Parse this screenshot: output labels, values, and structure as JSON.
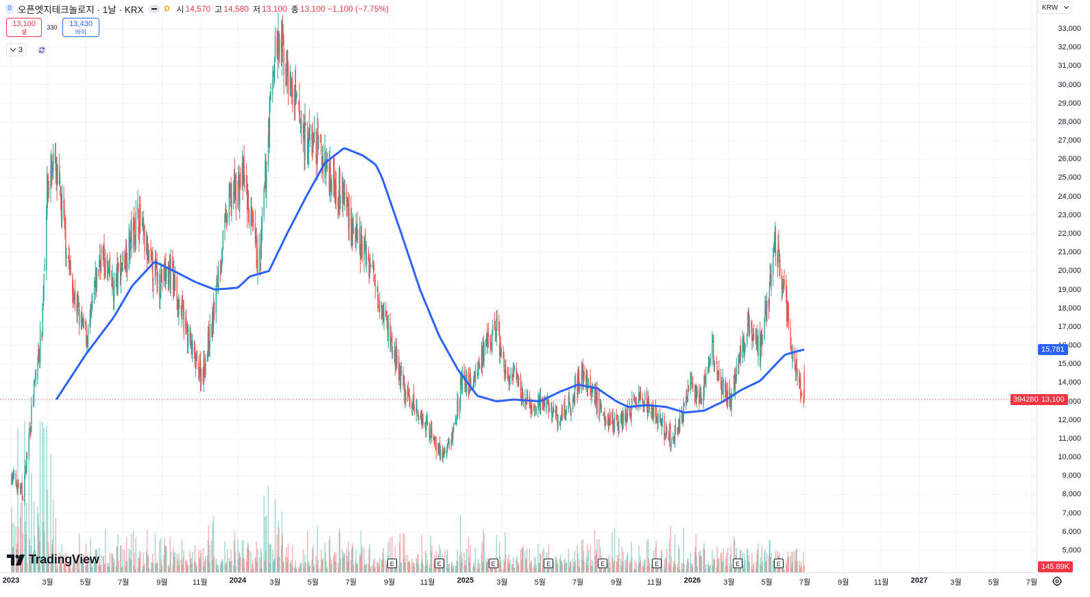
{
  "header": {
    "symbol_icon": "0",
    "title": "오픈엣지테크놀로지 · 1날 · KRX",
    "interval_badge": "D",
    "ohlc": [
      {
        "key": "시",
        "value": "14,570"
      },
      {
        "key": "고",
        "value": "14,580"
      },
      {
        "key": "저",
        "value": "13,100"
      },
      {
        "key": "종",
        "value": "13,100 −1,100 (−7.75%)"
      }
    ]
  },
  "trade": {
    "sell_price": "13,100",
    "sell_label": "셀",
    "spread": "330",
    "buy_price": "13,430",
    "buy_label": "바이"
  },
  "indicators": {
    "count": "3"
  },
  "currency": "KRW",
  "logo_text": "TradingView",
  "price_axis": {
    "ticks": [
      "33,000",
      "32,000",
      "31,000",
      "30,000",
      "29,000",
      "28,000",
      "27,000",
      "26,000",
      "25,000",
      "24,000",
      "23,000",
      "22,000",
      "21,000",
      "20,000",
      "19,000",
      "18,000",
      "17,000",
      "16,000",
      "15,000",
      "14,000",
      "13,000",
      "12,000",
      "11,000",
      "10,000",
      "9,000",
      "8,000",
      "7,000",
      "6,000",
      "5,000"
    ],
    "last_price_label": "13,100",
    "ma_label": "15,781",
    "volume_label": "145.89K",
    "volume_count_label": "394280"
  },
  "time_axis": {
    "labels": [
      {
        "text": "2023",
        "year": true
      },
      {
        "text": "3월"
      },
      {
        "text": "5월"
      },
      {
        "text": "7월"
      },
      {
        "text": "9월"
      },
      {
        "text": "11월"
      },
      {
        "text": "2024",
        "year": true
      },
      {
        "text": "3월"
      },
      {
        "text": "5월"
      },
      {
        "text": "7월"
      },
      {
        "text": "9월"
      },
      {
        "text": "11월"
      },
      {
        "text": "2025",
        "year": true
      },
      {
        "text": "3월"
      },
      {
        "text": "5월"
      },
      {
        "text": "7월"
      },
      {
        "text": "9월"
      },
      {
        "text": "11월"
      },
      {
        "text": "2026",
        "year": true
      },
      {
        "text": "3월"
      },
      {
        "text": "5월"
      },
      {
        "text": "7월"
      },
      {
        "text": "9월"
      },
      {
        "text": "11월"
      },
      {
        "text": "2027",
        "year": true
      },
      {
        "text": "3월"
      },
      {
        "text": "5월"
      },
      {
        "text": "7월"
      }
    ]
  },
  "events": [
    "E",
    "E",
    "E",
    "E",
    "E",
    "E",
    "E",
    "E"
  ],
  "colors": {
    "up": "#26a69a",
    "down": "#ef5350",
    "ma": "#2962ff",
    "last_price": "#f23645"
  },
  "chart_data": {
    "type": "candlestick",
    "x_start": "2023-01",
    "x_end": "2027-07",
    "ylim": [
      4500,
      33700
    ],
    "last_price": 13100,
    "ma_last": 15781,
    "close_anchors": [
      {
        "date": "2023-01-02",
        "value": 9000
      },
      {
        "date": "2023-01-20",
        "value": 8000
      },
      {
        "date": "2023-02-05",
        "value": 13000
      },
      {
        "date": "2023-02-20",
        "value": 17000
      },
      {
        "date": "2023-02-27",
        "value": 24000
      },
      {
        "date": "2023-03-10",
        "value": 26000
      },
      {
        "date": "2023-03-25",
        "value": 23000
      },
      {
        "date": "2023-04-10",
        "value": 19000
      },
      {
        "date": "2023-04-25",
        "value": 17000
      },
      {
        "date": "2023-05-05",
        "value": 16500
      },
      {
        "date": "2023-05-25",
        "value": 21000
      },
      {
        "date": "2023-06-15",
        "value": 19000
      },
      {
        "date": "2023-07-05",
        "value": 21000
      },
      {
        "date": "2023-07-25",
        "value": 23000
      },
      {
        "date": "2023-08-10",
        "value": 20500
      },
      {
        "date": "2023-08-28",
        "value": 19500
      },
      {
        "date": "2023-09-15",
        "value": 20000
      },
      {
        "date": "2023-10-05",
        "value": 17500
      },
      {
        "date": "2023-10-25",
        "value": 15000
      },
      {
        "date": "2023-11-05",
        "value": 14500
      },
      {
        "date": "2023-11-20",
        "value": 17000
      },
      {
        "date": "2023-12-05",
        "value": 21000
      },
      {
        "date": "2023-12-20",
        "value": 24000
      },
      {
        "date": "2024-01-10",
        "value": 25000
      },
      {
        "date": "2024-01-25",
        "value": 22000
      },
      {
        "date": "2024-02-05",
        "value": 20000
      },
      {
        "date": "2024-02-20",
        "value": 28000
      },
      {
        "date": "2024-03-01",
        "value": 32000
      },
      {
        "date": "2024-03-15",
        "value": 31500
      },
      {
        "date": "2024-04-01",
        "value": 29000
      },
      {
        "date": "2024-04-20",
        "value": 27000
      },
      {
        "date": "2024-05-10",
        "value": 26500
      },
      {
        "date": "2024-06-01",
        "value": 25000
      },
      {
        "date": "2024-06-20",
        "value": 24000
      },
      {
        "date": "2024-07-10",
        "value": 21500
      },
      {
        "date": "2024-07-25",
        "value": 21000
      },
      {
        "date": "2024-08-10",
        "value": 19500
      },
      {
        "date": "2024-08-25",
        "value": 17500
      },
      {
        "date": "2024-09-05",
        "value": 16000
      },
      {
        "date": "2024-09-25",
        "value": 13500
      },
      {
        "date": "2024-10-15",
        "value": 12500
      },
      {
        "date": "2024-11-05",
        "value": 11500
      },
      {
        "date": "2024-11-25",
        "value": 10000
      },
      {
        "date": "2024-12-10",
        "value": 11000
      },
      {
        "date": "2024-12-25",
        "value": 14000
      },
      {
        "date": "2025-01-10",
        "value": 14000
      },
      {
        "date": "2025-01-30",
        "value": 15500
      },
      {
        "date": "2025-02-20",
        "value": 17000
      },
      {
        "date": "2025-03-05",
        "value": 14500
      },
      {
        "date": "2025-03-25",
        "value": 14000
      },
      {
        "date": "2025-04-15",
        "value": 12500
      },
      {
        "date": "2025-05-10",
        "value": 13000
      },
      {
        "date": "2025-05-30",
        "value": 12000
      },
      {
        "date": "2025-06-20",
        "value": 13000
      },
      {
        "date": "2025-07-05",
        "value": 14500
      },
      {
        "date": "2025-07-25",
        "value": 13500
      },
      {
        "date": "2025-08-10",
        "value": 12500
      },
      {
        "date": "2025-08-30",
        "value": 11800
      },
      {
        "date": "2025-09-15",
        "value": 12200
      },
      {
        "date": "2025-10-05",
        "value": 13000
      },
      {
        "date": "2025-10-25",
        "value": 12800
      },
      {
        "date": "2025-11-10",
        "value": 11800
      },
      {
        "date": "2025-11-25",
        "value": 11000
      },
      {
        "date": "2025-12-10",
        "value": 11500
      },
      {
        "date": "2025-12-28",
        "value": 14000
      },
      {
        "date": "2026-01-15",
        "value": 13000
      },
      {
        "date": "2026-02-01",
        "value": 16000
      },
      {
        "date": "2026-02-15",
        "value": 14000
      },
      {
        "date": "2026-03-01",
        "value": 13000
      },
      {
        "date": "2026-03-15",
        "value": 15000
      },
      {
        "date": "2026-04-01",
        "value": 17000
      },
      {
        "date": "2026-04-20",
        "value": 16000
      },
      {
        "date": "2026-05-05",
        "value": 19000
      },
      {
        "date": "2026-05-15",
        "value": 21500
      },
      {
        "date": "2026-05-28",
        "value": 19000
      },
      {
        "date": "2026-06-10",
        "value": 16000
      },
      {
        "date": "2026-06-20",
        "value": 14000
      },
      {
        "date": "2026-06-30",
        "value": 13100
      }
    ],
    "ma_anchors": [
      {
        "date": "2023-03-15",
        "value": 13100
      },
      {
        "date": "2023-05-01",
        "value": 15500
      },
      {
        "date": "2023-06-15",
        "value": 17500
      },
      {
        "date": "2023-07-15",
        "value": 19200
      },
      {
        "date": "2023-08-20",
        "value": 20500
      },
      {
        "date": "2023-09-20",
        "value": 20000
      },
      {
        "date": "2023-10-25",
        "value": 19400
      },
      {
        "date": "2023-11-25",
        "value": 19000
      },
      {
        "date": "2024-01-01",
        "value": 19100
      },
      {
        "date": "2024-01-20",
        "value": 19700
      },
      {
        "date": "2024-02-20",
        "value": 20000
      },
      {
        "date": "2024-03-20",
        "value": 22000
      },
      {
        "date": "2024-04-20",
        "value": 24000
      },
      {
        "date": "2024-05-20",
        "value": 25800
      },
      {
        "date": "2024-06-20",
        "value": 26600
      },
      {
        "date": "2024-07-20",
        "value": 26200
      },
      {
        "date": "2024-08-10",
        "value": 25700
      },
      {
        "date": "2024-08-20",
        "value": 25000
      },
      {
        "date": "2024-09-20",
        "value": 22000
      },
      {
        "date": "2024-10-20",
        "value": 19000
      },
      {
        "date": "2024-11-20",
        "value": 16500
      },
      {
        "date": "2024-12-20",
        "value": 14700
      },
      {
        "date": "2025-01-20",
        "value": 13300
      },
      {
        "date": "2025-02-20",
        "value": 13000
      },
      {
        "date": "2025-03-20",
        "value": 13100
      },
      {
        "date": "2025-05-01",
        "value": 13000
      },
      {
        "date": "2025-06-01",
        "value": 13500
      },
      {
        "date": "2025-07-01",
        "value": 13900
      },
      {
        "date": "2025-08-01",
        "value": 13700
      },
      {
        "date": "2025-09-01",
        "value": 13000
      },
      {
        "date": "2025-09-20",
        "value": 12700
      },
      {
        "date": "2025-10-20",
        "value": 12800
      },
      {
        "date": "2025-11-20",
        "value": 12700
      },
      {
        "date": "2025-12-20",
        "value": 12400
      },
      {
        "date": "2026-01-20",
        "value": 12500
      },
      {
        "date": "2026-02-20",
        "value": 13000
      },
      {
        "date": "2026-03-20",
        "value": 13600
      },
      {
        "date": "2026-04-20",
        "value": 14100
      },
      {
        "date": "2026-05-10",
        "value": 14800
      },
      {
        "date": "2026-05-30",
        "value": 15500
      },
      {
        "date": "2026-06-20",
        "value": 15700
      },
      {
        "date": "2026-06-30",
        "value": 15781
      }
    ],
    "event_dates": [
      "2024-09-05",
      "2024-11-20",
      "2025-02-15",
      "2025-05-15",
      "2025-08-10",
      "2025-11-05",
      "2026-03-15",
      "2026-05-20"
    ]
  }
}
